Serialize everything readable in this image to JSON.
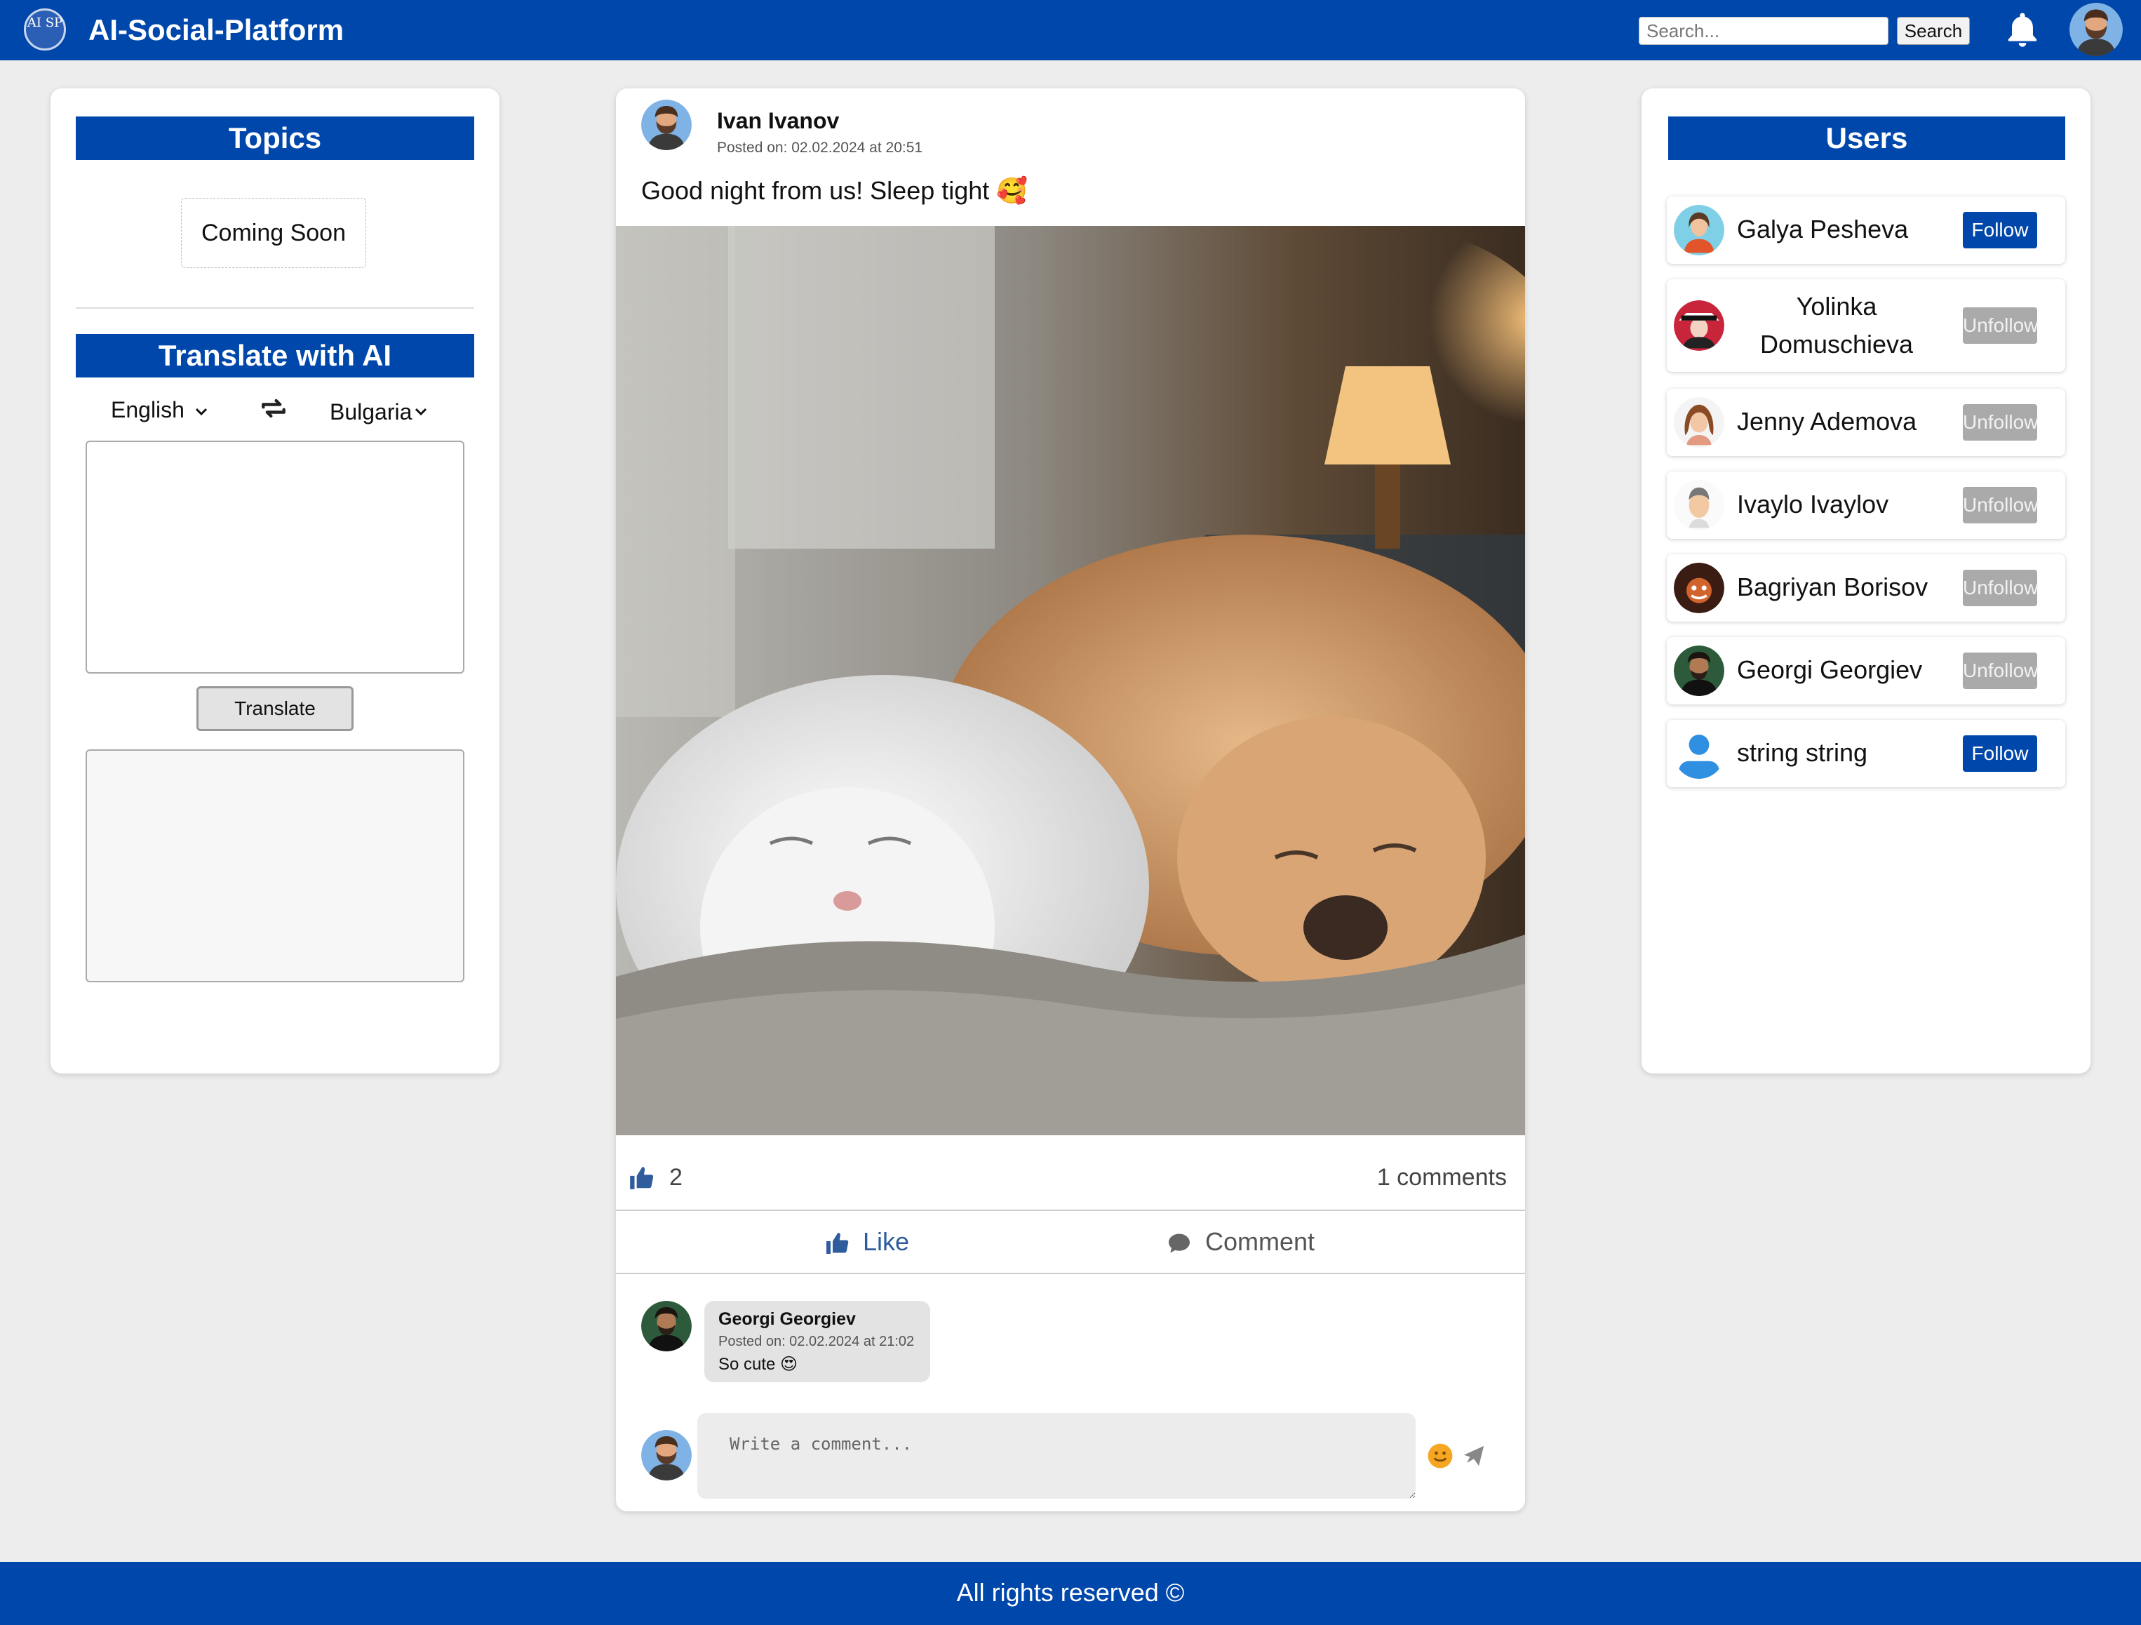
{
  "header": {
    "logo_text": "AI SP",
    "title": "AI-Social-Platform",
    "search_placeholder": "Search...",
    "search_button": "Search",
    "bell_icon": "bell-icon",
    "brand_color": "#0047ab"
  },
  "sidebar": {
    "topics_title": "Topics",
    "coming_soon": "Coming Soon",
    "translate_title": "Translate with AI",
    "lang_from": "English",
    "lang_to": "Bulgarian",
    "translate_button": "Translate"
  },
  "post": {
    "author": "Ivan Ivanov",
    "date": "Posted on: 02.02.2024 at 20:51",
    "text": "Good night from us! Sleep tight 🥰",
    "likes": "2",
    "comments_count": "1 comments",
    "like_label": "Like",
    "comment_label": "Comment",
    "comments": [
      {
        "author": "Georgi Georgiev",
        "date": "Posted on: 02.02.2024 at 21:02",
        "text": "So cute 😍"
      }
    ],
    "comment_placeholder": "Write a comment..."
  },
  "users": {
    "title": "Users",
    "list": [
      {
        "name": "Galya Pesheva",
        "action": "Follow"
      },
      {
        "name": "Yolinka Domuschieva",
        "action": "Unfollow"
      },
      {
        "name": "Jenny Ademova",
        "action": "Unfollow"
      },
      {
        "name": "Ivaylo Ivaylov",
        "action": "Unfollow"
      },
      {
        "name": "Bagriyan Borisov",
        "action": "Unfollow"
      },
      {
        "name": "Georgi Georgiev",
        "action": "Unfollow"
      },
      {
        "name": "string string",
        "action": "Follow"
      }
    ]
  },
  "footer": {
    "text": "All rights reserved ©"
  }
}
